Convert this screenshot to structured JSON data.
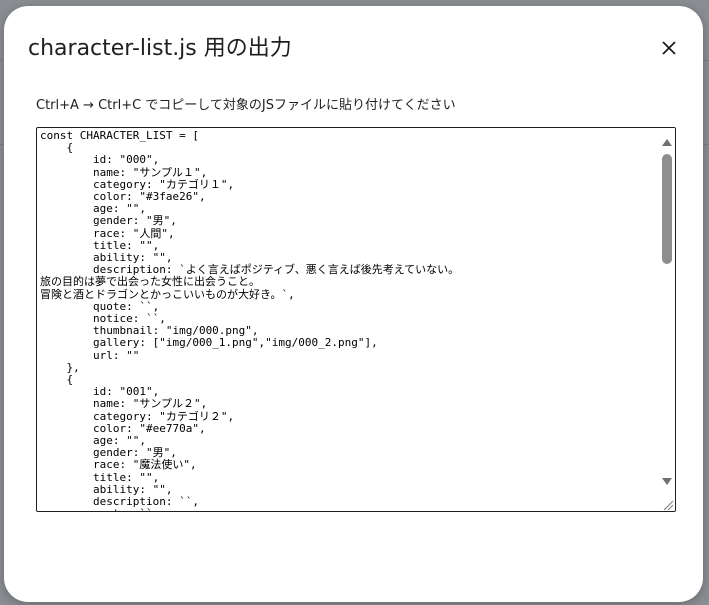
{
  "dialog": {
    "title": "character-list.js 用の出力",
    "close_icon": "close-icon",
    "instruction": "Ctrl+A → Ctrl+C でコピーして対象のJSファイルに貼り付けてください"
  },
  "output": {
    "content": "const CHARACTER_LIST = [\n    {\n        id: \"000\",\n        name: \"サンプル１\",\n        category: \"カテゴリ１\",\n        color: \"#3fae26\",\n        age: \"\",\n        gender: \"男\",\n        race: \"人間\",\n        title: \"\",\n        ability: \"\",\n        description: `よく言えばポジティブ、悪く言えば後先考えていない。\n旅の目的は夢で出会った女性に出会うこと。\n冒険と酒とドラゴンとかっこいいものが大好き。`,\n        quote: ``,\n        notice: ``,\n        thumbnail: \"img/000.png\",\n        gallery: [\"img/000_1.png\",\"img/000_2.png\"],\n        url: \"\"\n    },\n    {\n        id: \"001\",\n        name: \"サンプル２\",\n        category: \"カテゴリ２\",\n        color: \"#ee770a\",\n        age: \"\",\n        gender: \"男\",\n        race: \"魔法使い\",\n        title: \"\",\n        ability: \"\",\n        description: ``,\n        quote: ``"
  },
  "scrollbar": {
    "up_icon": "scroll-up-arrow-icon",
    "down_icon": "scroll-down-arrow-icon",
    "resize_icon": "resize-grip-icon"
  },
  "colors": {
    "dialog_bg": "#ffffff",
    "text": "#1f1f1f",
    "thumb": "#8e8e8e"
  }
}
